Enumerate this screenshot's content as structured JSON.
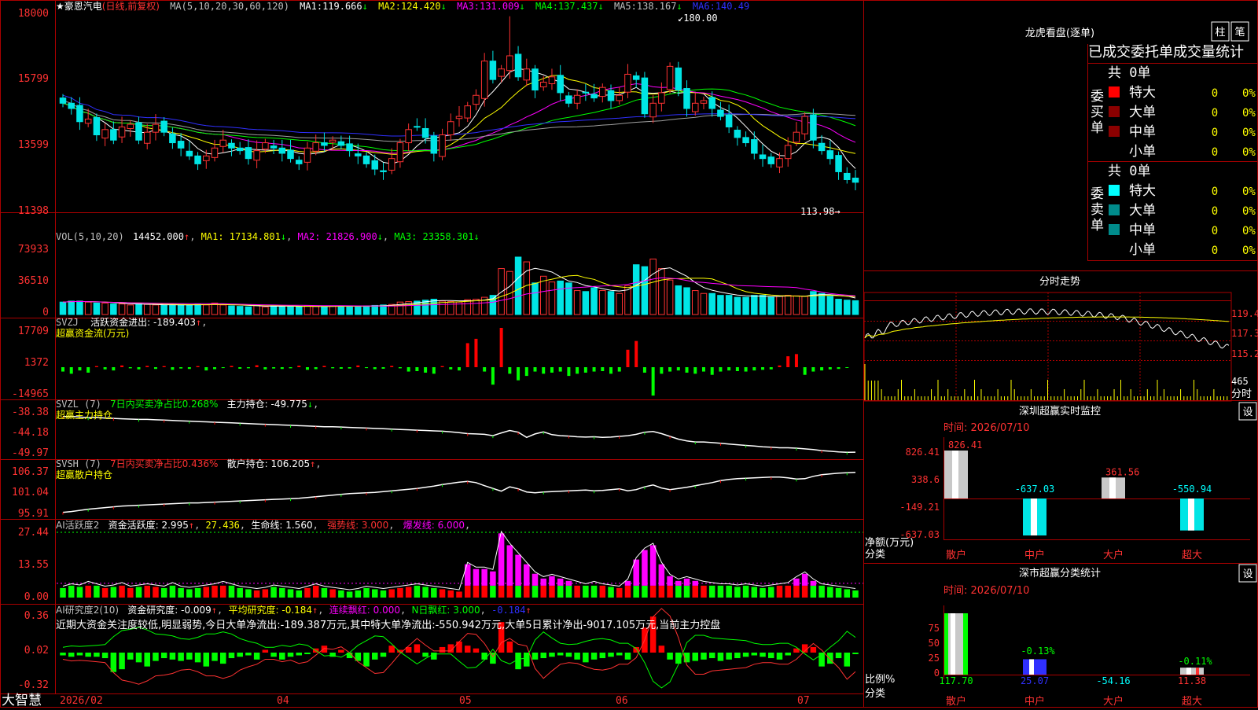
{
  "colors": {
    "up": "#ff3232",
    "down": "#00e5e5",
    "buy": "#ff0000",
    "sell": "#00ff00",
    "white": "#ffffff",
    "yellow": "#ffff00",
    "magenta": "#ff00ff",
    "green": "#00ff00",
    "blue": "#3030ff",
    "grey": "#a0a0a0",
    "frame": "#aa0000",
    "cyan": "#00ffff",
    "label": "#ff3232"
  },
  "main": {
    "star": "★",
    "name": "豪恩汽电",
    "mode": "(日线,前复权)",
    "ma_label": "MA(5,10,20,30,60,120)",
    "ma": [
      {
        "name": "MA1:",
        "value": "119.666"
      },
      {
        "name": "MA2:",
        "value": "124.420"
      },
      {
        "name": "MA3:",
        "value": "131.009"
      },
      {
        "name": "MA4:",
        "value": "137.437"
      },
      {
        "name": "MA5:",
        "value": "138.167"
      },
      {
        "name": "MA6:",
        "value": "140.49"
      }
    ],
    "y_ticks": [
      "18000",
      "15799",
      "13599",
      "11398"
    ],
    "high_note": "180.00",
    "low_note": "113.98"
  },
  "vol": {
    "label": "VOL(5,10,20)",
    "value": "14452.000",
    "ma1": "MA1: 17134.801",
    "ma2": "MA2: 21826.900",
    "ma3": "MA3: 23358.301",
    "y_ticks": [
      "73933",
      "36510",
      "0"
    ]
  },
  "svzj": {
    "label": "SVZJ",
    "line1": "活跃资金进出: -189.403",
    "line2": "超赢资金流(万元)",
    "y_ticks": [
      "17709",
      "1372",
      "-14965"
    ]
  },
  "svzl": {
    "label": "SVZL (7)",
    "t1": "7日内买卖净占比0.268%",
    "t2": "主力持仓: -49.775",
    "line2": "超赢主力持仓",
    "y_ticks": [
      "-38.38",
      "-44.18",
      "-49.97"
    ]
  },
  "svsh": {
    "label": "SVSH (7)",
    "t1": "7日内买卖净占比0.436%",
    "t2": "散户持仓: 106.205",
    "line2": "超赢散户持仓",
    "y_ticks": [
      "106.37",
      "101.04",
      "95.91"
    ]
  },
  "ai1": {
    "label": "AI活跃度2",
    "t1": "资金活跃度: 2.995",
    "t2": "27.436",
    "t3": "生命线: 1.560",
    "t4": "强势线: 3.000",
    "t5": "爆发线: 6.000",
    "y_ticks": [
      "27.44",
      "13.55",
      "0.00"
    ]
  },
  "ai2": {
    "label": "AI研究度2(10)",
    "t1": "资金研究度: -0.009",
    "t2": "平均研究度: -0.184",
    "t3": "连续飘红: 0.000",
    "t4": "N日飘红: 3.000",
    "t5": "-0.184",
    "note": "近期大资金关注度较低,明显弱势,今日大单净流出:-189.387万元,其中特大单净流出:-550.942万元,大单5日累计净出-9017.105万元,当前主力控盘",
    "y_ticks": [
      "0.36",
      "0.02",
      "-0.32"
    ]
  },
  "xaxis": {
    "logo": "大智慧",
    "labels": [
      "2026/02",
      "04",
      "05",
      "06",
      "07"
    ]
  },
  "lhb": {
    "title": "龙虎看盘(逐单)",
    "btn1": "柱",
    "btn2": "笔",
    "subtitle": "已成交委托单成交量统计",
    "buy_side": "委买单",
    "sell_side": "委卖单",
    "buy_total": "共 0单",
    "sell_total": "共 0单",
    "buy_rows": [
      {
        "name": "特大",
        "n": "0",
        "p": "0%"
      },
      {
        "name": "大单",
        "n": "0",
        "p": "0%"
      },
      {
        "name": "中单",
        "n": "0",
        "p": "0%"
      },
      {
        "name": "小单",
        "n": "0",
        "p": "0%"
      }
    ],
    "sell_rows": [
      {
        "name": "特大",
        "n": "0",
        "p": "0%"
      },
      {
        "name": "大单",
        "n": "0",
        "p": "0%"
      },
      {
        "name": "中单",
        "n": "0",
        "p": "0%"
      },
      {
        "name": "小单",
        "n": "0",
        "p": "0%"
      }
    ]
  },
  "intraday": {
    "title": "分时走势",
    "y_ticks": [
      "119.4",
      "117.3",
      "115.2"
    ],
    "vol_tick": "465",
    "vol_unit": "分时"
  },
  "sz_monitor": {
    "title": "深圳超赢实时监控",
    "btn": "设",
    "time": "时间: 2026/07/10",
    "y_ticks": [
      "826.41",
      "338.6",
      "-149.21",
      "-637.03"
    ],
    "ylabel1": "净额(万元)",
    "ylabel2": "分类",
    "cats": [
      "散户",
      "中户",
      "大户",
      "超大"
    ]
  },
  "sz_class": {
    "title": "深市超赢分类统计",
    "btn": "设",
    "time": "时间: 2026/07/10",
    "y_ticks": [
      "75",
      "50",
      "25",
      "0"
    ],
    "ylabel1": "比例%",
    "ylabel2": "分类",
    "cats": [
      "散户",
      "中户",
      "大户",
      "超大"
    ]
  },
  "chart_data": [
    {
      "type": "candlestick",
      "title": "豪恩汽电 (日线,前复权)",
      "ylim": [
        113.98,
        180.0
      ],
      "close": [
        147,
        145,
        140,
        141,
        135,
        137,
        133,
        138,
        139,
        133,
        136,
        139,
        136,
        132,
        130,
        127,
        124,
        127,
        130,
        133,
        130,
        129,
        126,
        129,
        132,
        130,
        128,
        126,
        124,
        130,
        132,
        131,
        133,
        131,
        129,
        127,
        124,
        122,
        121,
        126,
        132,
        137,
        138,
        134,
        128,
        135,
        140,
        142,
        146,
        150,
        163,
        156,
        160,
        165,
        157,
        160,
        152,
        155,
        157,
        151,
        147,
        150,
        151,
        149,
        153,
        148,
        150,
        158,
        156,
        143,
        147,
        151,
        161,
        152,
        145,
        147,
        148,
        145,
        142,
        138,
        134,
        132,
        128,
        126,
        124,
        126,
        131,
        136,
        142,
        133,
        129,
        126,
        121,
        118,
        117
      ]
    },
    {
      "type": "bar",
      "title": "VOL(5,10,20)",
      "ylim": [
        0,
        73933
      ],
      "values": [
        13000,
        14000,
        14000,
        13000,
        12000,
        12000,
        11000,
        11000,
        10000,
        11000,
        10500,
        10000,
        9500,
        10000,
        10500,
        10000,
        11000,
        10000,
        12000,
        10000,
        9000,
        8500,
        8000,
        10000,
        8000,
        9000,
        8000,
        9000,
        8000,
        9000,
        8500,
        8000,
        9000,
        9000,
        8500,
        9000,
        9000,
        9500,
        10000,
        10500,
        13000,
        13500,
        14000,
        15000,
        16000,
        14000,
        13500,
        13000,
        15500,
        16000,
        18000,
        20000,
        48000,
        45000,
        60000,
        55000,
        33000,
        40000,
        34000,
        35000,
        33000,
        25000,
        24000,
        28000,
        25000,
        24000,
        22000,
        30000,
        52000,
        50000,
        58000,
        48000,
        36000,
        30000,
        28000,
        25000,
        22000,
        22000,
        20000,
        20000,
        18000,
        18000,
        20000,
        20000,
        18000,
        19000,
        20000,
        19500,
        19000,
        24000,
        22000,
        19000,
        16000,
        15000,
        14452
      ]
    },
    {
      "type": "bar",
      "title": "SVZJ",
      "ylim": [
        -14965,
        17709
      ],
      "values": [
        -2000,
        -3000,
        -1500,
        -2500,
        500,
        -1000,
        -1500,
        800,
        -500,
        -1000,
        600,
        -800,
        500,
        -1200,
        -600,
        -800,
        500,
        -1500,
        -900,
        -400,
        600,
        -700,
        -500,
        900,
        -1000,
        -600,
        -800,
        -500,
        700,
        -1200,
        -900,
        600,
        -500,
        -700,
        -600,
        800,
        -400,
        -900,
        -700,
        600,
        -500,
        -2000,
        -1800,
        -2500,
        -3000,
        500,
        -1000,
        -1500,
        11000,
        13000,
        -2000,
        -8000,
        18000,
        -3000,
        -6000,
        -4000,
        -2000,
        -3000,
        -2500,
        -2000,
        -4000,
        -3000,
        -2500,
        -2000,
        -1800,
        -3000,
        -2000,
        8000,
        12000,
        -2500,
        -13000,
        -3000,
        -2000,
        -1500,
        -2500,
        -3000,
        -2000,
        -3500,
        -2000,
        -1500,
        -1800,
        -2000,
        -1500,
        -1200,
        -1000,
        800,
        5000,
        6000,
        -3500,
        -2000,
        -1500,
        -1000,
        -800,
        -189
      ]
    },
    {
      "type": "line",
      "title": "SVZL (7)",
      "ylim": [
        -49.97,
        -38.38
      ],
      "values": [
        -39.5,
        -39.4,
        -39.6,
        -39.8,
        -39.7,
        -39.9,
        -40.0,
        -40.1,
        -40.2,
        -40.3,
        -40.3,
        -40.4,
        -40.5,
        -40.6,
        -40.7,
        -40.8,
        -40.9,
        -41.0,
        -41.1,
        -41.2,
        -41.3,
        -41.4,
        -41.5,
        -41.6,
        -41.7,
        -41.8,
        -41.9,
        -42.0,
        -42.1,
        -42.2,
        -42.3,
        -42.4,
        -42.4,
        -42.5,
        -42.6,
        -42.7,
        -42.8,
        -42.9,
        -43.0,
        -43.1,
        -43.2,
        -43.3,
        -43.4,
        -43.5,
        -43.6,
        -43.7,
        -43.9,
        -44.1,
        -44.4,
        -44.5,
        -44.6,
        -45.0,
        -44.2,
        -43.5,
        -44.0,
        -45.5,
        -44.5,
        -43.9,
        -44.7,
        -45.0,
        -45.1,
        -45.3,
        -45.4,
        -45.3,
        -45.5,
        -45.4,
        -45.2,
        -45.0,
        -44.6,
        -44.0,
        -43.8,
        -44.4,
        -45.2,
        -46.0,
        -46.5,
        -46.8,
        -46.8,
        -47.0,
        -47.2,
        -47.4,
        -47.6,
        -47.8,
        -48.0,
        -48.2,
        -48.3,
        -48.5,
        -48.5,
        -48.6,
        -48.8,
        -49.0,
        -49.3,
        -49.5,
        -49.7,
        -49.8,
        -49.775
      ]
    },
    {
      "type": "line",
      "title": "SVSH (7)",
      "ylim": [
        95.91,
        106.37
      ],
      "values": [
        96.0,
        96.2,
        96.5,
        96.8,
        97.0,
        97.2,
        97.4,
        97.6,
        97.7,
        97.8,
        97.9,
        98.0,
        98.1,
        98.2,
        98.3,
        98.4,
        98.4,
        98.5,
        98.6,
        98.7,
        98.8,
        98.9,
        99.0,
        99.1,
        99.2,
        99.3,
        99.4,
        99.5,
        99.6,
        99.8,
        100.0,
        100.2,
        100.4,
        100.6,
        100.8,
        100.9,
        101.0,
        101.1,
        101.3,
        101.5,
        101.7,
        101.9,
        102.1,
        102.4,
        102.7,
        103.1,
        103.4,
        103.7,
        103.9,
        103.6,
        102.8,
        102.1,
        101.4,
        102.5,
        102.0,
        101.2,
        101.0,
        101.2,
        101.3,
        101.4,
        101.5,
        101.6,
        101.7,
        101.5,
        101.6,
        101.8,
        102.0,
        101.5,
        101.8,
        102.5,
        103.0,
        102.2,
        101.8,
        102.1,
        102.4,
        102.8,
        103.2,
        103.6,
        104.1,
        104.4,
        104.6,
        104.7,
        104.8,
        104.9,
        105.0,
        105.0,
        104.8,
        104.5,
        104.6,
        105.2,
        105.6,
        105.8,
        106.0,
        106.1,
        106.205
      ]
    },
    {
      "type": "bar",
      "title": "AI活跃度2",
      "ylim": [
        0,
        27.44
      ],
      "values": [
        4.0,
        5.0,
        4.5,
        6.0,
        5.0,
        4.0,
        4.5,
        5.5,
        4.0,
        4.5,
        5.0,
        4.5,
        4.0,
        5.5,
        4.0,
        3.5,
        4.0,
        4.5,
        5.0,
        6.0,
        5.0,
        4.0,
        3.5,
        3.0,
        3.5,
        4.5,
        4.0,
        3.5,
        3.0,
        4.0,
        5.0,
        4.0,
        3.5,
        3.0,
        2.5,
        3.0,
        4.0,
        3.5,
        3.0,
        3.5,
        4.0,
        4.5,
        5.0,
        4.5,
        4.0,
        3.5,
        3.0,
        2.5,
        14.0,
        12.0,
        12.0,
        11.0,
        27.0,
        22.0,
        18.0,
        14.0,
        10.0,
        8.0,
        9.0,
        8.0,
        7.0,
        6.0,
        5.0,
        6.0,
        5.0,
        4.5,
        4.0,
        7.0,
        16.0,
        20.0,
        22.0,
        14.0,
        9.0,
        7.0,
        8.0,
        7.0,
        6.0,
        5.5,
        5.0,
        5.0,
        4.5,
        5.0,
        4.5,
        4.0,
        4.5,
        5.0,
        5.5,
        8.0,
        10.0,
        7.0,
        5.0,
        4.5,
        4.0,
        3.5,
        2.995
      ]
    },
    {
      "type": "bar",
      "title": "AI研究度2(10)",
      "ylim": [
        -0.32,
        0.36
      ],
      "values": [
        -0.02,
        -0.03,
        -0.02,
        -0.03,
        -0.03,
        -0.04,
        -0.14,
        -0.12,
        -0.05,
        -0.07,
        -0.1,
        -0.06,
        -0.04,
        -0.05,
        -0.06,
        -0.05,
        -0.07,
        -0.1,
        -0.06,
        -0.08,
        -0.04,
        -0.03,
        -0.02,
        -0.05,
        0.02,
        -0.03,
        -0.05,
        -0.03,
        -0.02,
        -0.01,
        0.03,
        0.05,
        -0.03,
        0.02,
        -0.04,
        -0.06,
        -0.1,
        -0.05,
        -0.03,
        0.05,
        0.02,
        0.04,
        0.06,
        -0.03,
        -0.05,
        0.04,
        0.06,
        0.08,
        0.05,
        0.03,
        -0.05,
        -0.08,
        0.22,
        0.08,
        -0.12,
        -0.1,
        -0.05,
        -0.04,
        -0.03,
        -0.02,
        -0.03,
        -0.05,
        -0.07,
        -0.05,
        -0.04,
        -0.03,
        -0.02,
        -0.05,
        0.04,
        0.18,
        0.26,
        0.05,
        -0.05,
        -0.08,
        -0.07,
        -0.06,
        -0.05,
        -0.04,
        -0.06,
        -0.05,
        -0.04,
        -0.03,
        -0.02,
        -0.03,
        -0.04,
        -0.05,
        -0.02,
        0.03,
        0.06,
        0.04,
        -0.1,
        -0.08,
        -0.04,
        -0.1,
        -0.009
      ]
    },
    {
      "type": "bar",
      "title": "深圳超赢实时监控",
      "categories": [
        "散户",
        "中户",
        "大户",
        "超大"
      ],
      "values": [
        826.41,
        -637.03,
        361.56,
        -550.94
      ],
      "ylim": [
        -637.03,
        826.41
      ]
    },
    {
      "type": "bar",
      "title": "深市超赢分类统计",
      "categories": [
        "散户",
        "中户",
        "大户",
        "超大"
      ],
      "values": [
        117.7,
        25.07,
        -54.16,
        11.38
      ],
      "labels": [
        "-0.13%",
        "-0.11%"
      ],
      "ylim": [
        0,
        100
      ]
    }
  ]
}
